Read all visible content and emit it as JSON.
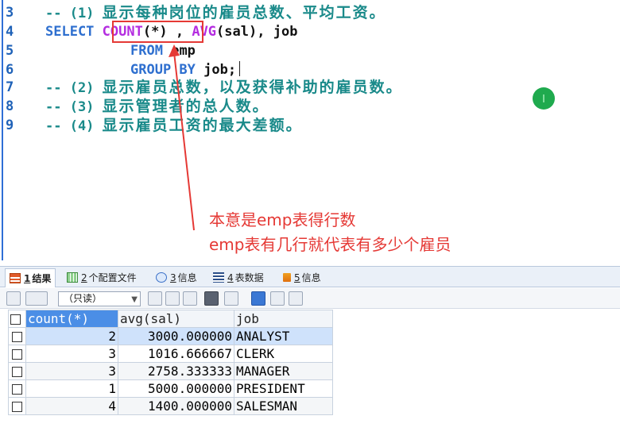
{
  "editor": {
    "lines": [
      {
        "num": "3",
        "comment_prefix": "-- (1)",
        "comment_text": "显示每种岗位的雇员总数、平均工资。"
      },
      {
        "num": "4",
        "kw": "SELECT",
        "fn1": "COUNT",
        "args1": "(*)",
        "sep1": ",",
        "fn2": "AVG",
        "args2": "(sal)",
        "sep2": ",",
        "col": "job"
      },
      {
        "num": "5",
        "kw": "FROM",
        "table": "emp"
      },
      {
        "num": "6",
        "kw": "GROUP BY",
        "col": "job;"
      },
      {
        "num": "7",
        "comment_prefix": "-- (2)",
        "comment_text": "显示雇员总数，以及获得补助的雇员数。"
      },
      {
        "num": "8",
        "comment_prefix": "-- (3)",
        "comment_text": "显示管理者的总人数。"
      },
      {
        "num": "9",
        "comment_prefix": "-- (4)",
        "comment_text": "显示雇员工资的最大差额。"
      }
    ]
  },
  "annotation": {
    "line1": "本意是emp表得行数",
    "line2": "emp表有几行就代表有多少个雇员",
    "color": "#e53935"
  },
  "result_tabs": [
    {
      "num": "1",
      "label": "结果",
      "icon": "result-grid-icon"
    },
    {
      "num": "2",
      "label": "个配置文件",
      "icon": "profile-icon"
    },
    {
      "num": "3",
      "label": "信息",
      "icon": "info-icon"
    },
    {
      "num": "4",
      "label": "表数据",
      "icon": "table-data-icon"
    },
    {
      "num": "5",
      "label": "信息",
      "icon": "info-icon"
    }
  ],
  "toolbar": {
    "mode": "（只读）"
  },
  "grid": {
    "columns": [
      "count(*)",
      "avg(sal)",
      "job"
    ],
    "rows": [
      [
        "2",
        "3000.000000",
        "ANALYST"
      ],
      [
        "3",
        "1016.666667",
        "CLERK"
      ],
      [
        "3",
        "2758.333333",
        "MANAGER"
      ],
      [
        "1",
        "5000.000000",
        "PRESIDENT"
      ],
      [
        "4",
        "1400.000000",
        "SALESMAN"
      ]
    ]
  }
}
